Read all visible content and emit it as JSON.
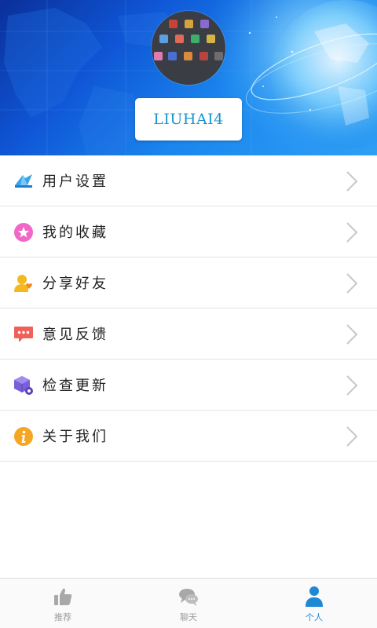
{
  "header": {
    "username": "LIUHAI4",
    "avatar": "app-grid-avatar"
  },
  "menu": {
    "items": [
      {
        "label": "用户设置",
        "icon": "paper-plane-icon",
        "color": "#3aa4e8"
      },
      {
        "label": "我的收藏",
        "icon": "star-badge-icon",
        "color": "#f067c8"
      },
      {
        "label": "分享好友",
        "icon": "user-heart-icon",
        "color": "#f5b821"
      },
      {
        "label": "意见反馈",
        "icon": "chat-bubble-icon",
        "color": "#f0605a"
      },
      {
        "label": "检查更新",
        "icon": "cube-gear-icon",
        "color": "#7b5fd8"
      },
      {
        "label": "关于我们",
        "icon": "info-circle-icon",
        "color": "#f5a623"
      }
    ]
  },
  "tabbar": {
    "tabs": [
      {
        "label": "推荐",
        "icon": "thumbs-up-icon",
        "active": false
      },
      {
        "label": "聊天",
        "icon": "chat-icon",
        "active": false
      },
      {
        "label": "个人",
        "icon": "person-icon",
        "active": true
      }
    ],
    "active_color": "#1e88d6",
    "inactive_color": "#9b9b9b"
  }
}
